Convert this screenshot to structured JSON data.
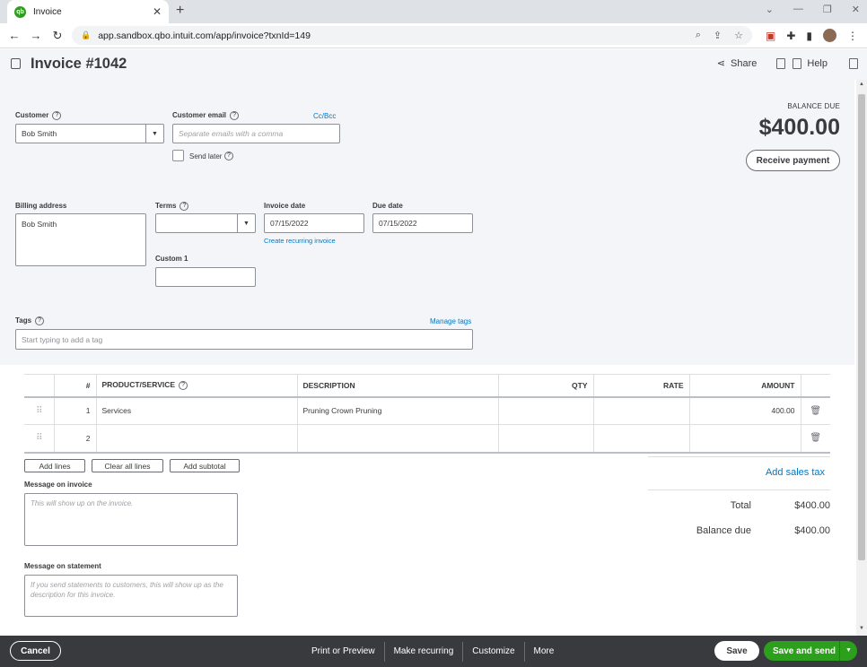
{
  "browser": {
    "tab_title": "Invoice",
    "favicon_text": "qb",
    "new_tab_symbol": "+",
    "url": "app.sandbox.qbo.intuit.com/app/invoice?txnId=149"
  },
  "header": {
    "title": "Invoice #1042",
    "share_label": "Share",
    "help_label": "Help"
  },
  "customer": {
    "label": "Customer",
    "value": "Bob Smith"
  },
  "customer_email": {
    "label": "Customer email",
    "placeholder": "Separate emails with a comma",
    "cc_bcc": "Cc/Bcc",
    "send_later": "Send later"
  },
  "balance": {
    "label": "BALANCE DUE",
    "amount": "$400.00",
    "receive_payment": "Receive payment"
  },
  "billing_address": {
    "label": "Billing address",
    "value": "Bob Smith"
  },
  "terms": {
    "label": "Terms",
    "value": ""
  },
  "invoice_date": {
    "label": "Invoice date",
    "value": "07/15/2022",
    "recurring_link": "Create recurring invoice"
  },
  "due_date": {
    "label": "Due date",
    "value": "07/15/2022"
  },
  "custom1": {
    "label": "Custom 1",
    "value": ""
  },
  "tags": {
    "label": "Tags",
    "manage": "Manage tags",
    "placeholder": "Start typing to add a tag"
  },
  "table": {
    "headers": {
      "num": "#",
      "product": "PRODUCT/SERVICE",
      "description": "DESCRIPTION",
      "qty": "QTY",
      "rate": "RATE",
      "amount": "AMOUNT"
    },
    "rows": [
      {
        "num": "1",
        "product": "Services",
        "description": "Pruning Crown Pruning",
        "qty": "",
        "rate": "",
        "amount": "400.00"
      },
      {
        "num": "2",
        "product": "",
        "description": "",
        "qty": "",
        "rate": "",
        "amount": ""
      }
    ],
    "add_lines": "Add lines",
    "clear_all_lines": "Clear all lines",
    "add_subtotal": "Add subtotal"
  },
  "message_invoice": {
    "label": "Message on invoice",
    "placeholder": "This will show up on the invoice."
  },
  "message_statement": {
    "label": "Message on statement",
    "placeholder": "If you send statements to customers, this will show up as the description for this invoice."
  },
  "totals": {
    "add_sales_tax": "Add sales tax",
    "total_label": "Total",
    "total_value": "$400.00",
    "balance_due_label": "Balance due",
    "balance_due_value": "$400.00"
  },
  "footer": {
    "cancel": "Cancel",
    "print_preview": "Print or Preview",
    "make_recurring": "Make recurring",
    "customize": "Customize",
    "more": "More",
    "save": "Save",
    "save_and_send": "Save and send"
  },
  "colors": {
    "brand_green": "#2ca01c",
    "link_blue": "#0077c5",
    "footer_bg": "#393a3d",
    "form_bg": "#f4f5f8"
  }
}
